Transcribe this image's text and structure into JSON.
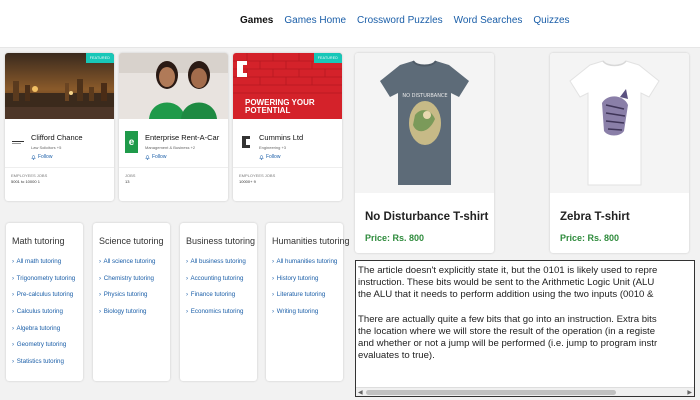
{
  "nav": {
    "items": [
      "Games",
      "Games Home",
      "Crossword Puzzles",
      "Word Searches",
      "Quizzes"
    ],
    "active_index": 0
  },
  "companies": [
    {
      "tag": "FEATURED",
      "name": "Clifford Chance",
      "meta": "Law Solicitors +5",
      "follow": "Follow",
      "stats_header": "EMPLOYEES    JOBS",
      "stats_values": "5001 to 10000    1",
      "logo": "cc-logo"
    },
    {
      "tag": "",
      "name": "Enterprise Rent-A-Car",
      "meta": "Management & Business +2",
      "follow": "Follow",
      "stats_header": "JOBS",
      "stats_values": "13",
      "logo": "e-logo"
    },
    {
      "tag": "FEATURED",
      "name": "Cummins Ltd",
      "meta": "Engineering +3",
      "follow": "Follow",
      "stats_header": "EMPLOYEES    JOBS",
      "stats_values": "10000+    9",
      "logo": "cummins-logo",
      "banner_text": "POWERING YOUR POTENTIAL"
    }
  ],
  "products": [
    {
      "title": "No Disturbance T-shirt",
      "price": "Price: Rs. 800",
      "shirt_color": "#5d6b78",
      "print_text": "NO DISTURBANCE"
    },
    {
      "title": "Zebra T-shirt",
      "price": "Price: Rs. 800",
      "shirt_color": "#ffffff"
    }
  ],
  "tutoring": [
    {
      "title": "Math tutoring",
      "links": [
        "All math tutoring",
        "Trigonometry tutoring",
        "Pre-calculus tutoring",
        "Calculus tutoring",
        "Algebra tutoring",
        "Geometry tutoring",
        "Statistics tutoring"
      ]
    },
    {
      "title": "Science tutoring",
      "links": [
        "All science tutoring",
        "Chemistry tutoring",
        "Physics tutoring",
        "Biology tutoring"
      ]
    },
    {
      "title": "Business tutoring",
      "links": [
        "All business tutoring",
        "Accounting tutoring",
        "Finance tutoring",
        "Economics tutoring"
      ]
    },
    {
      "title": "Humanities tutoring",
      "links": [
        "All humanities tutoring",
        "History tutoring",
        "Literature tutoring",
        "Writing tutoring"
      ]
    }
  ],
  "article": {
    "paragraphs": [
      [
        "The article doesn't explicitly state it, but the 0101 is likely used to repre",
        "instruction. These bits would be sent to the Arithmetic Logic Unit (ALU",
        "the ALU that it needs to perform addition using the two inputs (0010 &"
      ],
      [
        "There are actually quite a few bits that go into an instruction. Extra bits",
        "the location where we will store the result of the operation (in a registe",
        "and whether or not a jump will be performed (i.e. jump to program instr",
        "evaluates to true)."
      ]
    ]
  },
  "colors": {
    "link": "#1a5ea8",
    "price": "#2e8b3c",
    "tag": "#18c7b8"
  }
}
